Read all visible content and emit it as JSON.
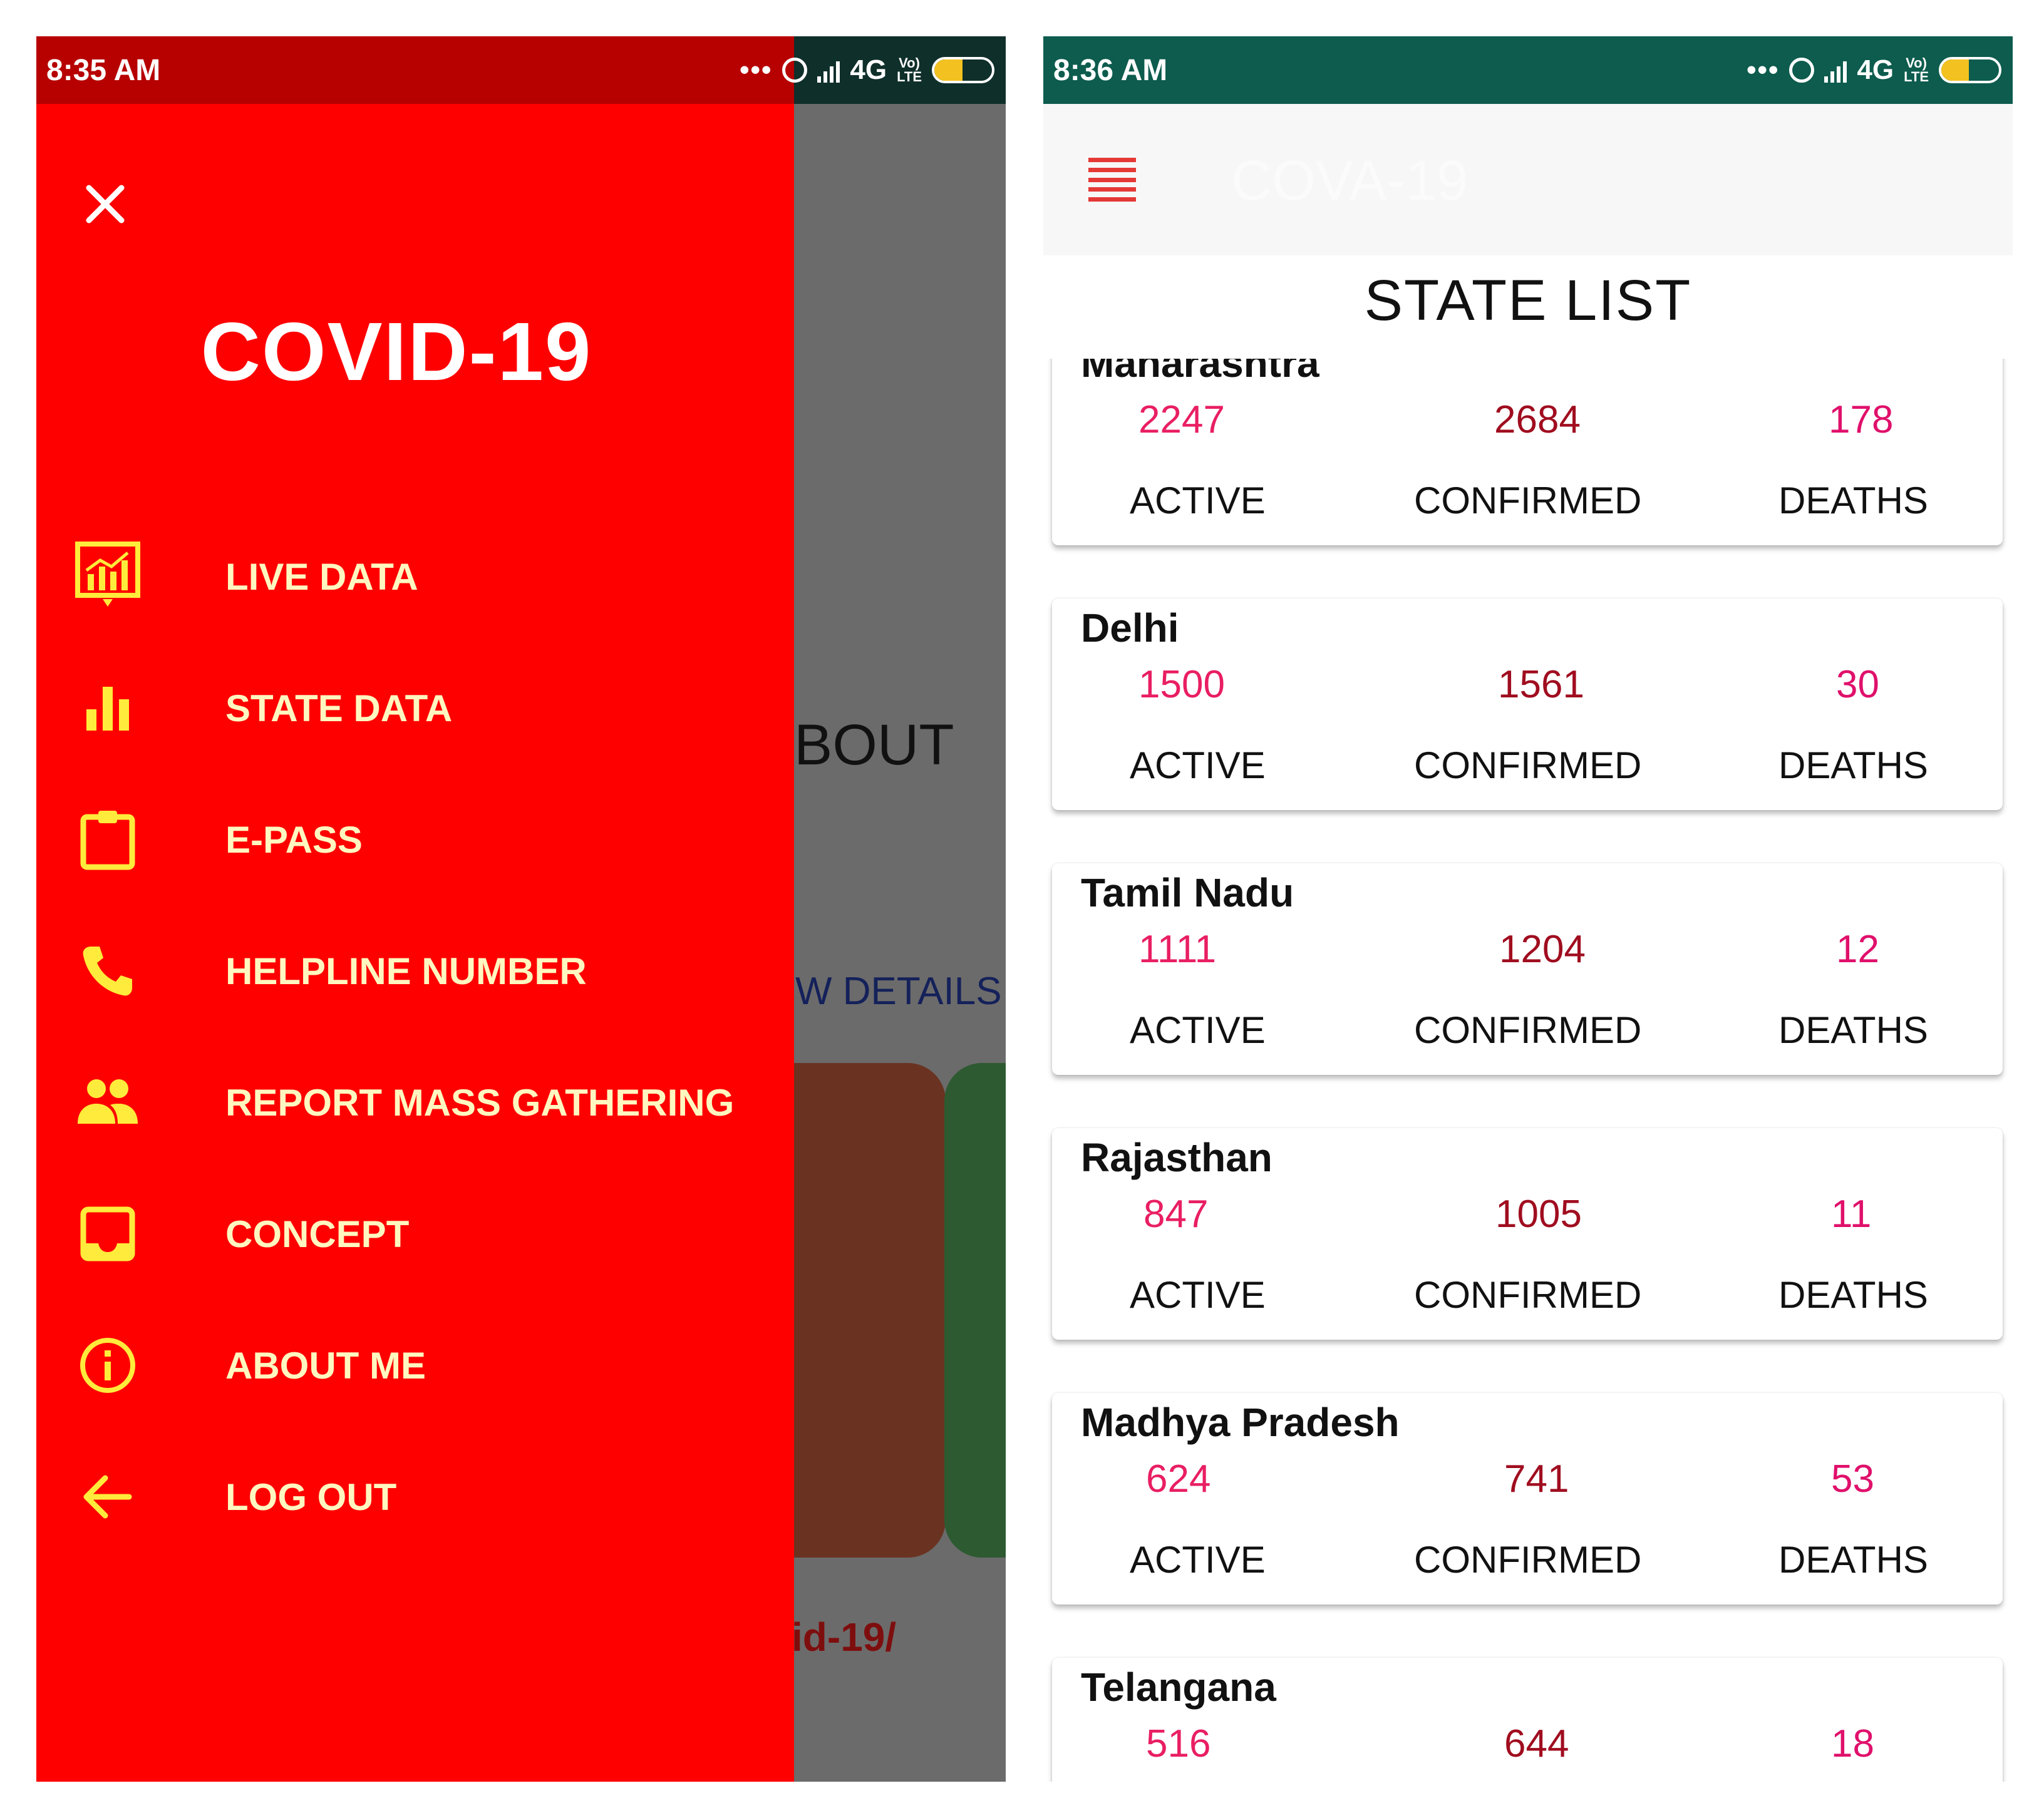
{
  "left_screen": {
    "status_bar": {
      "time": "8:35 AM",
      "network": "4G",
      "volte": "Vo)) LTE",
      "battery": "49",
      "battery_level": 0.49
    },
    "background": {
      "about_text": "BOUT",
      "details_text": "W DETAILS",
      "link_text": "id-19/"
    },
    "drawer": {
      "title": "COVID-19",
      "items": [
        {
          "label": "LIVE DATA",
          "icon": "live-chart-icon"
        },
        {
          "label": "STATE DATA",
          "icon": "bar-chart-icon"
        },
        {
          "label": "E-PASS",
          "icon": "clipboard-icon"
        },
        {
          "label": "HELPLINE NUMBER",
          "icon": "phone-icon"
        },
        {
          "label": "REPORT MASS GATHERING",
          "icon": "people-icon"
        },
        {
          "label": "CONCEPT",
          "icon": "inbox-icon"
        },
        {
          "label": "ABOUT ME",
          "icon": "info-icon"
        },
        {
          "label": "LOG OUT",
          "icon": "arrow-left-icon"
        }
      ]
    },
    "colors": {
      "drawer": "#ff0000",
      "status": "#b70000",
      "icon": "#ffeb3b"
    }
  },
  "right_screen": {
    "status_bar": {
      "time": "8:36 AM",
      "network": "4G",
      "volte": "Vo)) LTE",
      "battery": "48",
      "battery_level": 0.48
    },
    "app_title": "COVA-19",
    "list_title": "STATE LIST",
    "labels": {
      "active": "ACTIVE",
      "confirmed": "CONFIRMED",
      "deaths": "DEATHS"
    },
    "states": [
      {
        "name": "Maharashtra",
        "active": "2247",
        "confirmed": "2684",
        "deaths": "178"
      },
      {
        "name": "Delhi",
        "active": "1500",
        "confirmed": "1561",
        "deaths": "30"
      },
      {
        "name": "Tamil Nadu",
        "active": "1111",
        "confirmed": "1204",
        "deaths": "12"
      },
      {
        "name": "Rajasthan",
        "active": "847",
        "confirmed": "1005",
        "deaths": "11"
      },
      {
        "name": "Madhya Pradesh",
        "active": "624",
        "confirmed": "741",
        "deaths": "53"
      },
      {
        "name": "Telangana",
        "active": "516",
        "confirmed": "644",
        "deaths": "18"
      }
    ],
    "colors": {
      "status": "#0d5c4e",
      "active": "#e91e63",
      "confirmed": "#a00d1f"
    }
  }
}
